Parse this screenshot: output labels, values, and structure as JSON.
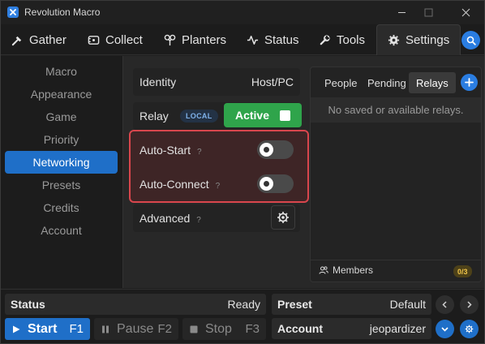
{
  "window": {
    "title": "Revolution Macro",
    "app_icon": "app-logo-icon",
    "controls": [
      "minimize-icon",
      "maximize-icon",
      "close-icon"
    ]
  },
  "tabs": [
    {
      "label": "Gather",
      "icon": "gather-icon",
      "active": false
    },
    {
      "label": "Collect",
      "icon": "collect-icon",
      "active": false
    },
    {
      "label": "Planters",
      "icon": "planters-icon",
      "active": false
    },
    {
      "label": "Status",
      "icon": "status-icon",
      "active": false
    },
    {
      "label": "Tools",
      "icon": "tools-icon",
      "active": false
    },
    {
      "label": "Settings",
      "icon": "settings-icon",
      "active": true
    }
  ],
  "sidebar": {
    "items": [
      {
        "label": "Macro",
        "active": false
      },
      {
        "label": "Appearance",
        "active": false
      },
      {
        "label": "Game",
        "active": false
      },
      {
        "label": "Priority",
        "active": false
      },
      {
        "label": "Networking",
        "active": true
      },
      {
        "label": "Presets",
        "active": false
      },
      {
        "label": "Credits",
        "active": false
      },
      {
        "label": "Account",
        "active": false
      }
    ]
  },
  "networking": {
    "identity": {
      "label": "Identity",
      "value": "Host/PC"
    },
    "relay": {
      "label": "Relay",
      "badge": "LOCAL",
      "button_label": "Active",
      "checked": true
    },
    "auto_start": {
      "label": "Auto-Start",
      "help": "?",
      "enabled": false
    },
    "auto_connect": {
      "label": "Auto-Connect",
      "help": "?",
      "enabled": false
    },
    "advanced": {
      "label": "Advanced",
      "help": "?"
    }
  },
  "relays_panel": {
    "tabs": [
      {
        "label": "People",
        "active": false
      },
      {
        "label": "Pending",
        "active": false
      },
      {
        "label": "Relays",
        "active": true
      }
    ],
    "empty_message": "No saved or available relays.",
    "members_label": "Members",
    "members_count": "0/3"
  },
  "bottom": {
    "status": {
      "label": "Status",
      "value": "Ready"
    },
    "preset": {
      "label": "Preset",
      "value": "Default"
    },
    "account": {
      "label": "Account",
      "value": "jeopardizer"
    },
    "start": {
      "label": "Start",
      "key": "F1"
    },
    "pause": {
      "label": "Pause",
      "key": "F2"
    },
    "stop": {
      "label": "Stop",
      "key": "F3"
    }
  },
  "colors": {
    "accent": "#1f6fc8",
    "active_green": "#2fa44b",
    "highlight_red": "#d9464d"
  }
}
